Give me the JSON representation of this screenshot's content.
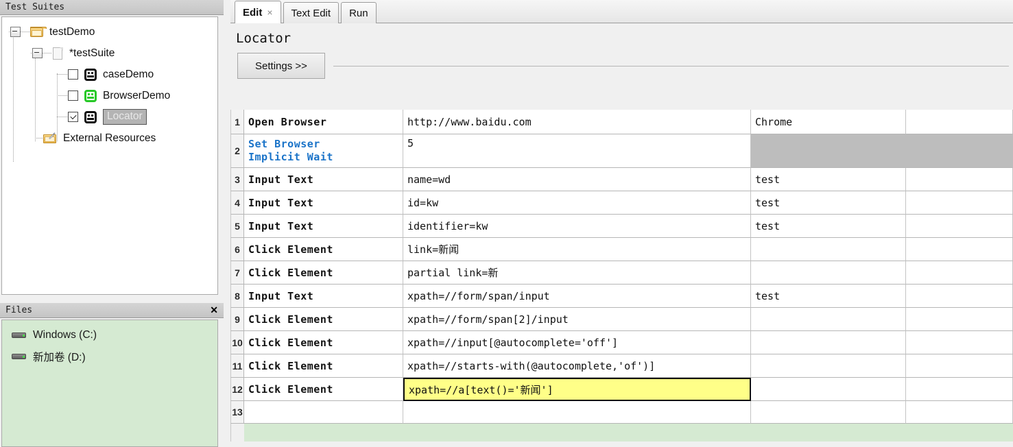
{
  "left": {
    "suites_panel": {
      "title": "Test Suites",
      "tree": [
        {
          "label": "testDemo",
          "icon": "folder-icon",
          "type": "folder",
          "expanded": true
        },
        {
          "label": "*testSuite",
          "icon": "file-icon",
          "type": "file",
          "expanded": true
        },
        {
          "label": "caseDemo",
          "icon": "robot-icon",
          "type": "case",
          "checked": false,
          "green": false
        },
        {
          "label": "BrowserDemo",
          "icon": "robot-icon",
          "type": "case",
          "checked": false,
          "green": true
        },
        {
          "label": "Locator",
          "icon": "robot-icon",
          "type": "case",
          "checked": true,
          "green": false,
          "selected": true
        },
        {
          "label": "External Resources",
          "icon": "external-resources-icon",
          "type": "external"
        }
      ]
    },
    "files_panel": {
      "title": "Files",
      "close_label": "✕",
      "items": [
        {
          "label": "Windows (C:)",
          "icon": "drive-icon"
        },
        {
          "label": "新加卷 (D:)",
          "icon": "drive-icon"
        }
      ]
    }
  },
  "editor": {
    "tabs": [
      {
        "label": "Edit",
        "active": true,
        "closable": true,
        "close_label": "×"
      },
      {
        "label": "Text Edit",
        "active": false,
        "closable": false
      },
      {
        "label": "Run",
        "active": false,
        "closable": false
      }
    ],
    "doc_title": "Locator",
    "settings_button": "Settings >>",
    "grid": {
      "rows": [
        {
          "n": "1",
          "c1": "Open Browser",
          "c2": "http://www.baidu.com",
          "c3": "Chrome",
          "c4": "",
          "blue": false,
          "grayfill": false
        },
        {
          "n": "2",
          "c1": "Set Browser\nImplicit Wait",
          "c2": "5",
          "c3": "",
          "c4": "",
          "blue": true,
          "grayfill": true
        },
        {
          "n": "3",
          "c1": "Input Text",
          "c2": "name=wd",
          "c3": "test",
          "c4": "",
          "blue": false,
          "grayfill": false
        },
        {
          "n": "4",
          "c1": "Input Text",
          "c2": "id=kw",
          "c3": "test",
          "c4": "",
          "blue": false,
          "grayfill": false
        },
        {
          "n": "5",
          "c1": "Input Text",
          "c2": "identifier=kw",
          "c3": "test",
          "c4": "",
          "blue": false,
          "grayfill": false
        },
        {
          "n": "6",
          "c1": "Click Element",
          "c2": "link=新闻",
          "c3": "",
          "c4": "",
          "blue": false,
          "grayfill": false
        },
        {
          "n": "7",
          "c1": "Click Element",
          "c2": "partial link=新",
          "c3": "",
          "c4": "",
          "blue": false,
          "grayfill": false
        },
        {
          "n": "8",
          "c1": "Input Text",
          "c2": "xpath=//form/span/input",
          "c3": "test",
          "c4": "",
          "blue": false,
          "grayfill": false
        },
        {
          "n": "9",
          "c1": "Click Element",
          "c2": "xpath=//form/span[2]/input",
          "c3": "",
          "c4": "",
          "blue": false,
          "grayfill": false
        },
        {
          "n": "10",
          "c1": "Click Element",
          "c2": "xpath=//input[@autocomplete='off']",
          "c3": "",
          "c4": "",
          "blue": false,
          "grayfill": false
        },
        {
          "n": "11",
          "c1": "Click Element",
          "c2": "xpath=//starts-with(@autocomplete,'of')]",
          "c3": "",
          "c4": "",
          "blue": false,
          "grayfill": false
        },
        {
          "n": "12",
          "c1": "Click Element",
          "c2": "xpath=//a[text()='新闻']",
          "c3": "",
          "c4": "",
          "blue": false,
          "grayfill": false,
          "selected_cell": 2
        },
        {
          "n": "13",
          "c1": "",
          "c2": "",
          "c3": "",
          "c4": "",
          "blue": false,
          "grayfill": false
        }
      ]
    }
  },
  "colors": {
    "keyword_blue": "#1a73c8",
    "selection_yellow": "#ffff88",
    "files_green": "#d5ead2",
    "disabled_gray": "#bdbdbd",
    "robot_green": "#27c927"
  }
}
